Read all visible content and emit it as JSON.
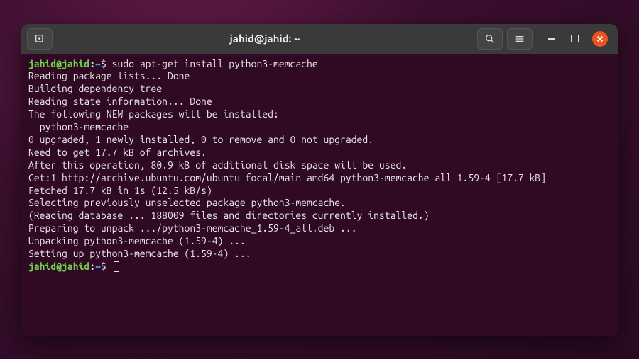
{
  "window": {
    "title": "jahid@jahid: ~"
  },
  "prompt": {
    "user_host": "jahid@jahid",
    "path": "~",
    "symbol": "$"
  },
  "command": "sudo apt-get install python3-memcache",
  "output": [
    "Reading package lists... Done",
    "Building dependency tree",
    "Reading state information... Done",
    "The following NEW packages will be installed:",
    "  python3-memcache",
    "0 upgraded, 1 newly installed, 0 to remove and 0 not upgraded.",
    "Need to get 17.7 kB of archives.",
    "After this operation, 80.9 kB of additional disk space will be used.",
    "Get:1 http://archive.ubuntu.com/ubuntu focal/main amd64 python3-memcache all 1.59-4 [17.7 kB]",
    "Fetched 17.7 kB in 1s (12.5 kB/s)",
    "Selecting previously unselected package python3-memcache.",
    "(Reading database ... 188009 files and directories currently installed.)",
    "Preparing to unpack .../python3-memcache_1.59-4_all.deb ...",
    "Unpacking python3-memcache (1.59-4) ...",
    "Setting up python3-memcache (1.59-4) ..."
  ]
}
